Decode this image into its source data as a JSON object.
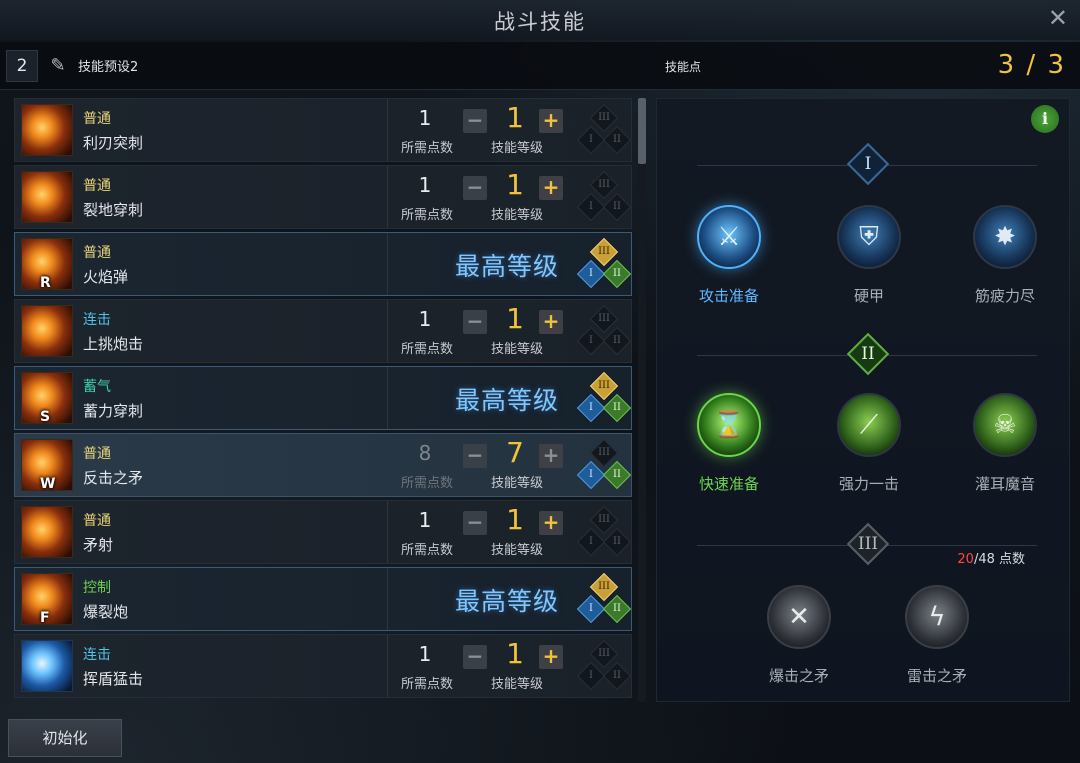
{
  "window": {
    "title": "战斗技能"
  },
  "preset": {
    "number": "2",
    "name": "技能预设2"
  },
  "skill_points": {
    "label": "技能点",
    "value": "3 / 3"
  },
  "labels": {
    "cost": "所需点数",
    "level": "技能等级",
    "max": "最高等级",
    "minus": "−",
    "plus": "+"
  },
  "tier_numerals": [
    "I",
    "II",
    "III"
  ],
  "skills": [
    {
      "type": "普通",
      "type_color": "#e8d27a",
      "name": "利刃突刺",
      "state": "normal",
      "cost": "1",
      "level": "1",
      "key": "",
      "tiers_on": [
        false,
        false,
        false
      ]
    },
    {
      "type": "普通",
      "type_color": "#e8d27a",
      "name": "裂地穿刺",
      "state": "normal",
      "cost": "1",
      "level": "1",
      "key": "",
      "tiers_on": [
        false,
        false,
        false
      ]
    },
    {
      "type": "普通",
      "type_color": "#e8d27a",
      "name": "火焰弹",
      "state": "max",
      "cost": "",
      "level": "",
      "key": "R",
      "tiers_on": [
        true,
        true,
        true
      ]
    },
    {
      "type": "连击",
      "type_color": "#4fc3e8",
      "name": "上挑炮击",
      "state": "normal",
      "cost": "1",
      "level": "1",
      "key": "",
      "tiers_on": [
        false,
        false,
        false
      ]
    },
    {
      "type": "蓄气",
      "type_color": "#3fd1a8",
      "name": "蓄力穿刺",
      "state": "max",
      "cost": "",
      "level": "",
      "key": "S",
      "tiers_on": [
        true,
        true,
        true
      ]
    },
    {
      "type": "普通",
      "type_color": "#e8d27a",
      "name": "反击之矛",
      "state": "selected",
      "cost": "8",
      "level": "7",
      "key": "W",
      "tiers_on": [
        true,
        true,
        false
      ]
    },
    {
      "type": "普通",
      "type_color": "#e8d27a",
      "name": "矛射",
      "state": "normal",
      "cost": "1",
      "level": "1",
      "key": "",
      "tiers_on": [
        false,
        false,
        false
      ]
    },
    {
      "type": "控制",
      "type_color": "#6ed24f",
      "name": "爆裂炮",
      "state": "max",
      "cost": "",
      "level": "",
      "key": "F",
      "tiers_on": [
        true,
        true,
        true
      ]
    },
    {
      "type": "连击",
      "type_color": "#4fc3e8",
      "name": "挥盾猛击",
      "state": "normal",
      "cost": "1",
      "level": "1",
      "key": "",
      "tiers_on": [
        false,
        false,
        false
      ]
    }
  ],
  "tripods": {
    "tier1": {
      "numeral": "I",
      "nodes": [
        {
          "name": "攻击准备",
          "icon": "crossed-swords-icon",
          "state": "on"
        },
        {
          "name": "硬甲",
          "icon": "shield-icon",
          "state": "off"
        },
        {
          "name": "筋疲力尽",
          "icon": "exhaustion-icon",
          "state": "off"
        }
      ]
    },
    "tier2": {
      "numeral": "II",
      "nodes": [
        {
          "name": "快速准备",
          "icon": "hourglass-icon",
          "state": "on"
        },
        {
          "name": "强力一击",
          "icon": "strike-icon",
          "state": "off"
        },
        {
          "name": "灌耳魔音",
          "icon": "skull-icon",
          "state": "off"
        }
      ]
    },
    "tier3": {
      "numeral": "III",
      "points_current": "20",
      "points_rest": "/48 点数",
      "nodes": [
        {
          "name": "爆击之矛",
          "icon": "crit-spear-icon",
          "state": "off"
        },
        {
          "name": "雷击之矛",
          "icon": "lightning-spear-icon",
          "state": "off"
        }
      ]
    }
  },
  "reset_label": "初始化",
  "scrollbar": {
    "position": 0.0
  }
}
